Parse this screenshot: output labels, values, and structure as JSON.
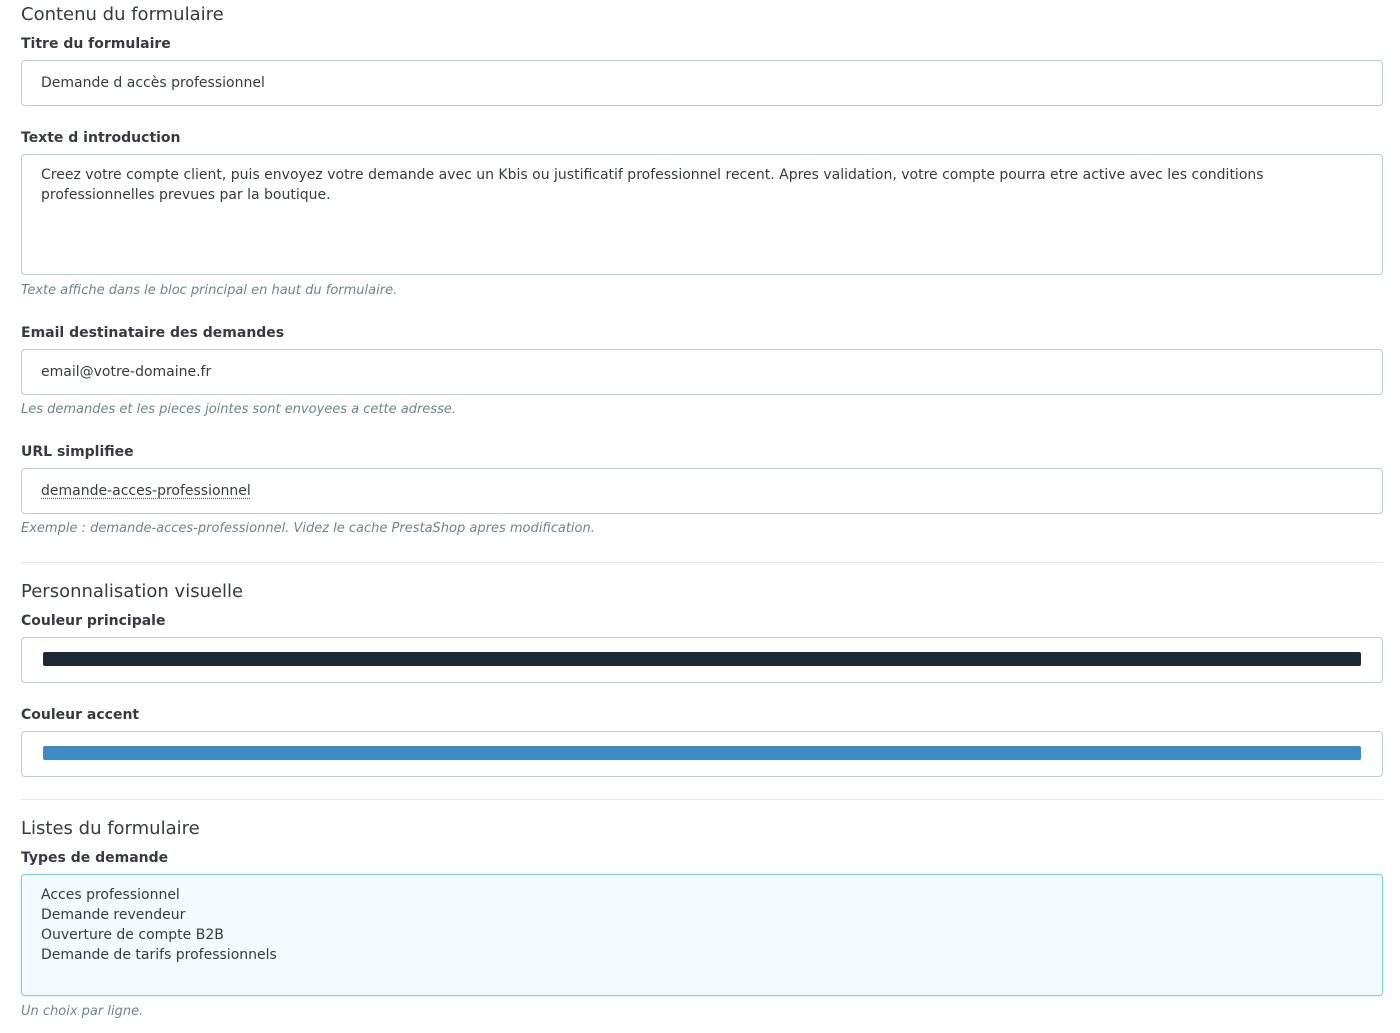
{
  "content_section": {
    "title": "Contenu du formulaire",
    "form_title": {
      "label": "Titre du formulaire",
      "value": "Demande d accès professionnel"
    },
    "intro_text": {
      "label": "Texte d introduction",
      "value": "Creez votre compte client, puis envoyez votre demande avec un Kbis ou justificatif professionnel recent. Apres validation, votre compte pourra etre active avec les conditions professionnelles prevues par la boutique.",
      "help": "Texte affiche dans le bloc principal en haut du formulaire."
    },
    "recipient_email": {
      "label": "Email destinataire des demandes",
      "value": "email@votre-domaine.fr",
      "help": "Les demandes et les pieces jointes sont envoyees a cette adresse."
    },
    "friendly_url": {
      "label": "URL simplifiee",
      "value": "demande-acces-professionnel",
      "help": "Exemple : demande-acces-professionnel. Videz le cache PrestaShop apres modification."
    }
  },
  "visual_section": {
    "title": "Personnalisation visuelle",
    "primary_color": {
      "label": "Couleur principale",
      "value": "#1b2a34"
    },
    "accent_color": {
      "label": "Couleur accent",
      "value": "#3b8bc5"
    }
  },
  "lists_section": {
    "title": "Listes du formulaire",
    "request_types": {
      "label": "Types de demande",
      "value": "Acces professionnel\nDemande revendeur\nOuverture de compte B2B\nDemande de tarifs professionnels",
      "help": "Un choix par ligne."
    }
  }
}
